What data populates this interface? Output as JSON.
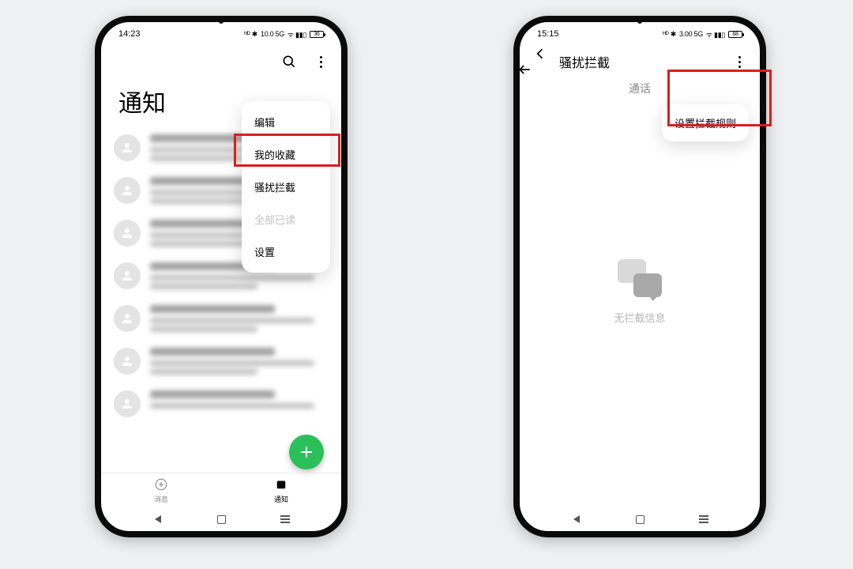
{
  "left": {
    "status": {
      "time": "14:23",
      "right_text": "10.0 5G",
      "battery": "36"
    },
    "title": "通知",
    "menu": {
      "items": [
        "编辑",
        "我的收藏",
        "骚扰拦截",
        "全部已读",
        "设置"
      ],
      "disabled_index": 3
    },
    "tabs": {
      "messages": "消息",
      "notify": "通知"
    }
  },
  "right": {
    "status": {
      "time": "15:15",
      "right_text": "3.00 5G",
      "battery": "68"
    },
    "header_title": "骚扰拦截",
    "call_tab": "通话",
    "popup": "设置拦截规则",
    "empty_text": "无拦截信息"
  }
}
